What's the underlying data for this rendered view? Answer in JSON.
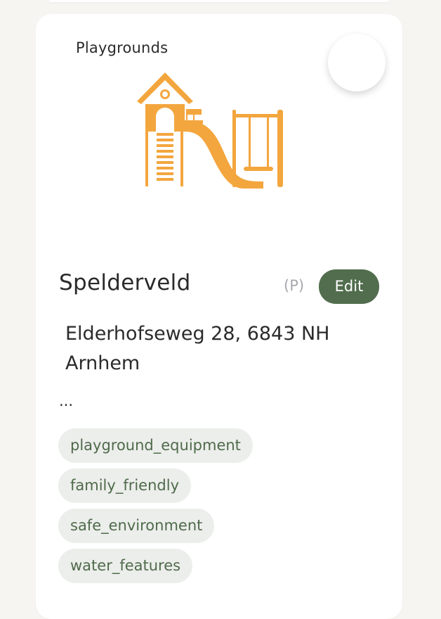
{
  "card": {
    "category": "Playgrounds",
    "title": "Spelderveld",
    "badge": "(P)",
    "edit_label": "Edit",
    "address_line1": "Elderhofseweg 28, 6843 NH",
    "address_line2": "Arnhem",
    "description": "...",
    "tags": [
      "playground_equipment",
      "family_friendly",
      "safe_environment",
      "water_features"
    ]
  },
  "colors": {
    "accent_orange": "#f3a63e",
    "edit_green": "#516d4d",
    "tag_bg": "#eceeeb",
    "tag_text": "#4f6a4b",
    "page_bg": "#f6f5f1"
  },
  "icons": {
    "illustration": "playground-icon",
    "favorite": "favorite-button"
  }
}
